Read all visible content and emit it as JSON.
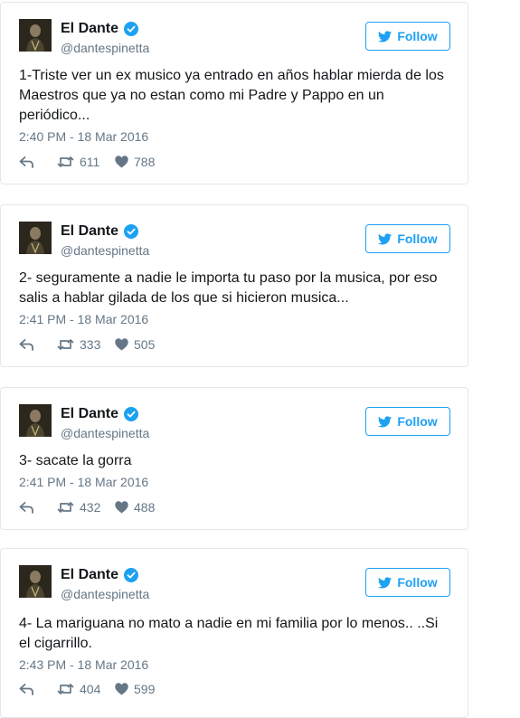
{
  "brand_color": "#1da1f2",
  "tweets": [
    {
      "author": "El Dante",
      "handle": "@dantespinetta",
      "follow_label": "Follow",
      "text": "1-Triste ver un ex musico ya entrado en años hablar mierda de los Maestros que ya no estan como mi Padre y Pappo en un periódico...",
      "timestamp": "2:40 PM - 18 Mar 2016",
      "retweets": "611",
      "likes": "788"
    },
    {
      "author": "El Dante",
      "handle": "@dantespinetta",
      "follow_label": "Follow",
      "text": "2- seguramente a nadie le importa tu paso por la musica, por eso salis a hablar gilada de los que si hicieron musica...",
      "timestamp": "2:41 PM - 18 Mar 2016",
      "retweets": "333",
      "likes": "505"
    },
    {
      "author": "El Dante",
      "handle": "@dantespinetta",
      "follow_label": "Follow",
      "text": "3- sacate la gorra",
      "timestamp": "2:41 PM - 18 Mar 2016",
      "retweets": "432",
      "likes": "488"
    },
    {
      "author": "El Dante",
      "handle": "@dantespinetta",
      "follow_label": "Follow",
      "text": "4- La mariguana no mato a nadie en mi familia por lo menos.. ..Si el cigarrillo.",
      "timestamp": "2:43 PM - 18 Mar 2016",
      "retweets": "404",
      "likes": "599"
    }
  ]
}
